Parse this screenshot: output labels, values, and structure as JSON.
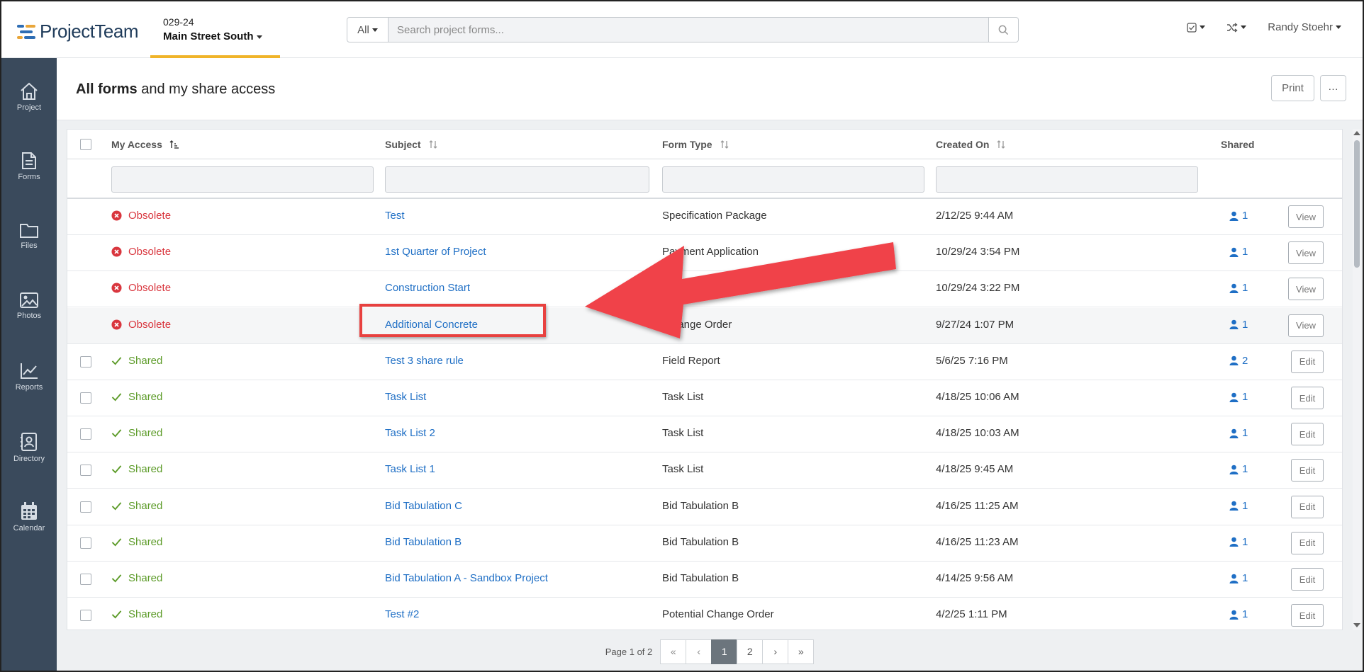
{
  "header": {
    "logo_text": "ProjectTeam",
    "project_code": "029-24",
    "project_name": "Main Street South",
    "search_filter": "All",
    "search_placeholder": "Search project forms...",
    "user_name": "Randy Stoehr"
  },
  "sidebar": {
    "items": [
      {
        "label": "Project",
        "icon": "home-icon"
      },
      {
        "label": "Forms",
        "icon": "document-icon"
      },
      {
        "label": "Files",
        "icon": "folder-icon"
      },
      {
        "label": "Photos",
        "icon": "image-icon"
      },
      {
        "label": "Reports",
        "icon": "chart-icon"
      },
      {
        "label": "Directory",
        "icon": "contact-card-icon"
      },
      {
        "label": "Calendar",
        "icon": "calendar-icon"
      }
    ]
  },
  "page": {
    "title_bold": "All forms",
    "title_rest": " and my share access",
    "print_label": "Print",
    "more_label": "···"
  },
  "table": {
    "columns": {
      "access": "My Access",
      "subject": "Subject",
      "form_type": "Form Type",
      "created_on": "Created On",
      "shared": "Shared"
    },
    "rows": [
      {
        "access": "Obsolete",
        "status": "obsolete",
        "subject": "Test",
        "form_type": "Specification Package",
        "created_on": "2/12/25 9:44 AM",
        "shared": "1",
        "action": "View"
      },
      {
        "access": "Obsolete",
        "status": "obsolete",
        "subject": "1st Quarter of Project",
        "form_type": "Payment Application",
        "created_on": "10/29/24 3:54 PM",
        "shared": "1",
        "action": "View"
      },
      {
        "access": "Obsolete",
        "status": "obsolete",
        "subject": "Construction Start",
        "form_type": "",
        "created_on": "10/29/24 3:22 PM",
        "shared": "1",
        "action": "View"
      },
      {
        "access": "Obsolete",
        "status": "obsolete",
        "subject": "Additional Concrete",
        "form_type": "hange Order",
        "created_on": "9/27/24 1:07 PM",
        "shared": "1",
        "action": "View"
      },
      {
        "access": "Shared",
        "status": "shared",
        "subject": "Test 3 share rule",
        "form_type": "Field Report",
        "created_on": "5/6/25 7:16 PM",
        "shared": "2",
        "action": "Edit"
      },
      {
        "access": "Shared",
        "status": "shared",
        "subject": "Task List",
        "form_type": "Task List",
        "created_on": "4/18/25 10:06 AM",
        "shared": "1",
        "action": "Edit"
      },
      {
        "access": "Shared",
        "status": "shared",
        "subject": "Task List 2",
        "form_type": "Task List",
        "created_on": "4/18/25 10:03 AM",
        "shared": "1",
        "action": "Edit"
      },
      {
        "access": "Shared",
        "status": "shared",
        "subject": "Task List 1",
        "form_type": "Task List",
        "created_on": "4/18/25 9:45 AM",
        "shared": "1",
        "action": "Edit"
      },
      {
        "access": "Shared",
        "status": "shared",
        "subject": "Bid Tabulation C",
        "form_type": "Bid Tabulation B",
        "created_on": "4/16/25 11:25 AM",
        "shared": "1",
        "action": "Edit"
      },
      {
        "access": "Shared",
        "status": "shared",
        "subject": "Bid Tabulation B",
        "form_type": "Bid Tabulation B",
        "created_on": "4/16/25 11:23 AM",
        "shared": "1",
        "action": "Edit"
      },
      {
        "access": "Shared",
        "status": "shared",
        "subject": "Bid Tabulation A - Sandbox Project",
        "form_type": "Bid Tabulation B",
        "created_on": "4/14/25 9:56 AM",
        "shared": "1",
        "action": "Edit"
      },
      {
        "access": "Shared",
        "status": "shared",
        "subject": "Test #2",
        "form_type": "Potential Change Order",
        "created_on": "4/2/25 1:11 PM",
        "shared": "1",
        "action": "Edit"
      }
    ]
  },
  "pager": {
    "label": "Page 1 of 2",
    "first": "«",
    "prev": "‹",
    "pages": [
      "1",
      "2"
    ],
    "next": "›",
    "last": "»"
  },
  "colors": {
    "obsolete": "#d9363e",
    "shared": "#5c9b28",
    "link": "#1f6fc5",
    "sidebar": "#3a4a5c",
    "annotation": "#e8413f"
  }
}
